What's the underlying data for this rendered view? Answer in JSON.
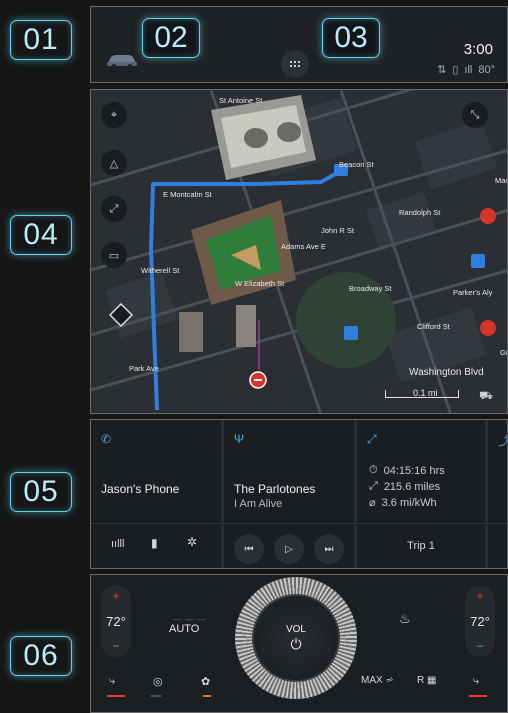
{
  "callouts": [
    "01",
    "02",
    "03",
    "04",
    "05",
    "06"
  ],
  "header": {
    "time": "3:00",
    "status_text": "80°",
    "apps_icon": "grid-icon"
  },
  "map": {
    "streets": [
      "St Antoine St",
      "Beacon St",
      "E Montcalm St",
      "John R St",
      "Randolph St",
      "Adams Ave E",
      "Witherell St",
      "W Elizabeth St",
      "Broadway St",
      "Parker's Aly",
      "Clifford St",
      "Park Ave",
      "Washington Blvd",
      "Mac",
      "Gr"
    ],
    "scale_label": "0.1 mi"
  },
  "cards": {
    "phone": {
      "name": "Jason's Phone"
    },
    "media": {
      "artist": "The Parlotones",
      "track": "I Am Alive"
    },
    "trip": {
      "duration": "04:15:16 hrs",
      "distance": "215.6 miles",
      "efficiency": "3.6 mi/kWh",
      "label": "Trip 1"
    }
  },
  "climate": {
    "left_temp": "72°",
    "right_temp": "72°",
    "auto_label": "AUTO",
    "vol_label": "VOL",
    "max_label": "MAX",
    "rear_label": "R"
  },
  "colors": {
    "accent": "#4aa8e0",
    "callout": "#5fd3ee",
    "route": "#2f7fe0",
    "heat": "#e23b3b"
  }
}
